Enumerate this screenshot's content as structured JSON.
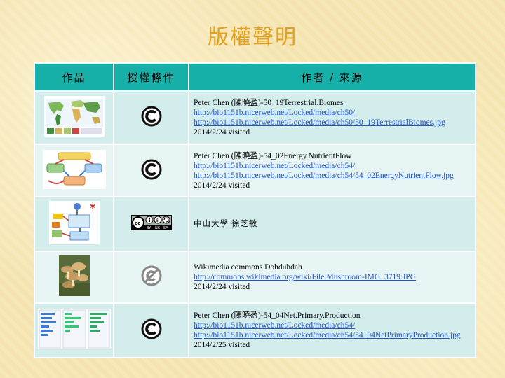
{
  "title": "版權聲明",
  "headers": {
    "work": "作品",
    "license": "授權條件",
    "author": "作者 / 來源"
  },
  "rows": [
    {
      "thumb": "world-biomes-map-thumbnail",
      "license_icon": "cc-copyright-icon",
      "author": "Peter Chen (陳曉盈)-50_19Terrestrial.Biomes",
      "link1": "http://bio1151b.nicerweb.net/Locked/media/ch50/",
      "link2": "http://bio1151b.nicerweb.net/Locked/media/ch50/50_19TerrestrialBiomes.jpg",
      "date": "2014/2/24 visited"
    },
    {
      "thumb": "energy-nutrient-flow-diagram-thumbnail",
      "license_icon": "cc-copyright-icon",
      "author": "Peter Chen (陳曉盈)-54_02Energy.NutrientFlow",
      "link1": "http://bio1151b.nicerweb.net/Locked/media/ch54/",
      "link2": "http://bio1151b.nicerweb.net/Locked/media/ch54/54_02EnergyNutrientFlow.jpg",
      "date": "2014/2/24 visited"
    },
    {
      "thumb": "food-chain-diagram-thumbnail",
      "license_icon": "cc-by-nc-sa-badge",
      "badge_text": [
        "BY",
        "NC",
        "SA"
      ],
      "author": "中山大學 徐芝敏"
    },
    {
      "thumb": "mushroom-photo-thumbnail",
      "license_icon": "public-domain-icon",
      "author": "Wikimedia commons Dohduhdah",
      "link1": "http://commons.wikimedia.org/wiki/File:Mushroom-IMG_3719.JPG",
      "date": "2014/2/24 visited"
    },
    {
      "thumb": "net-primary-production-chart-thumbnail",
      "license_icon": "cc-copyright-icon",
      "author": "Peter Chen (陳曉盈)-54_04Net.Primary.Production",
      "link1": "http://bio1151b.nicerweb.net/Locked/media/ch54/",
      "link2": "http://bio1151b.nicerweb.net/Locked/media/ch54/54_04NetPrimaryProduction.jpg",
      "date": "2014/2/25 visited"
    }
  ]
}
